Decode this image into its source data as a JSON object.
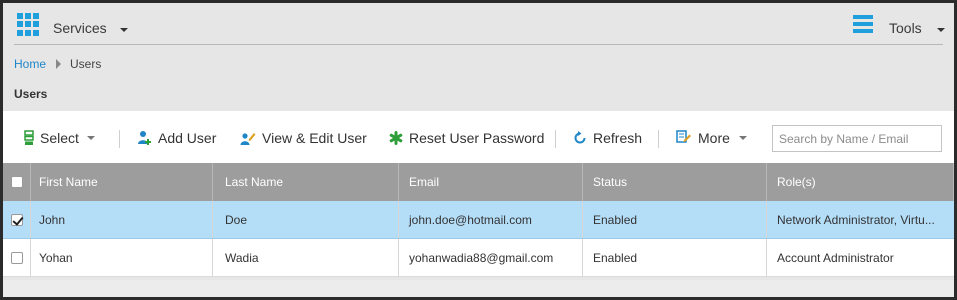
{
  "header": {
    "services_label": "Services",
    "tools_label": "Tools"
  },
  "breadcrumb": {
    "home": "Home",
    "current": "Users"
  },
  "page_title": "Users",
  "toolbar": {
    "select_label": "Select",
    "add_user_label": "Add User",
    "view_edit_label": "View & Edit User",
    "reset_password_label": "Reset User Password",
    "refresh_label": "Refresh",
    "more_label": "More"
  },
  "search": {
    "placeholder": "Search by Name / Email",
    "value": ""
  },
  "table": {
    "columns": [
      "First Name",
      "Last Name",
      "Email",
      "Status",
      "Role(s)"
    ],
    "rows": [
      {
        "checked": true,
        "first_name": "John",
        "last_name": "Doe",
        "email": "john.doe@hotmail.com",
        "status": "Enabled",
        "roles": "Network Administrator, Virtu..."
      },
      {
        "checked": false,
        "first_name": "Yohan",
        "last_name": "Wadia",
        "email": "yohanwadia88@gmail.com",
        "status": "Enabled",
        "roles": "Account Administrator"
      }
    ]
  },
  "icons": {
    "apps": "waffle-grid-icon",
    "tools": "hamburger-icon",
    "select": "select-icon",
    "add_user": "add-user-icon",
    "view_edit": "edit-user-icon",
    "reset_password": "asterisk-icon",
    "refresh": "refresh-icon",
    "more": "more-icon"
  },
  "colors": {
    "accent": "#1fa0dd",
    "link": "#1f86c8",
    "selected_row": "#b4ddf8",
    "header_row": "#9d9d9d",
    "green_icon": "#2e9e3a"
  }
}
